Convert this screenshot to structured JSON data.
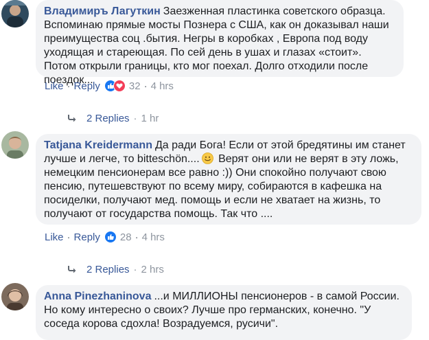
{
  "comments": [
    {
      "author": "Владимиръ Лагуткин",
      "text": "Заезженная пластинка советского образца. Вспоминаю прямые мосты Познера с США, как он доказывал наши преимущества соц .бытия. Негры в коробках , Европа под воду уходящая и стареющая. По сей день в ушах и глазах «стоит». Потом открыли границы, кто мог поехал. Долго отходили после поездок...",
      "like_label": "Like",
      "reply_label": "Reply",
      "reaction_count": "32",
      "time": "4 hrs",
      "replies_label": "2 Replies",
      "replies_time": "1 hr"
    },
    {
      "author": "Tatjana Kreidermann",
      "text_before_emoji": "Да ради Бога! Если от этой бредятины им станет лучше и легче, то bitteschön....",
      "text_after_emoji": " Верят они или не верят в эту ложь, немецким пенсионерам все равно :)) Они спокойно получают свою пенсию, путешевствуют по всему миру, собираются в кафешка на посиделки, получают мед. помощь и если не хватает на жизнь, то получают от государства помощь. Так что ....",
      "like_label": "Like",
      "reply_label": "Reply",
      "reaction_count": "28",
      "time": "4 hrs",
      "replies_label": "2 Replies",
      "replies_time": "2 hrs"
    },
    {
      "author": "Anna Pinezhaninova",
      "text": "...и МИЛЛИОНЫ пенсионеров - в самой России. Но кому интересно о своих? Лучше про германских, конечно. \"У соседа корова сдохла! Возрадуемся, русичи\"."
    }
  ],
  "colors": {
    "link": "#385898",
    "meta": "#8d949e",
    "bubble": "#f2f3f5",
    "like": "#1877f2",
    "love": "#f33e58"
  }
}
